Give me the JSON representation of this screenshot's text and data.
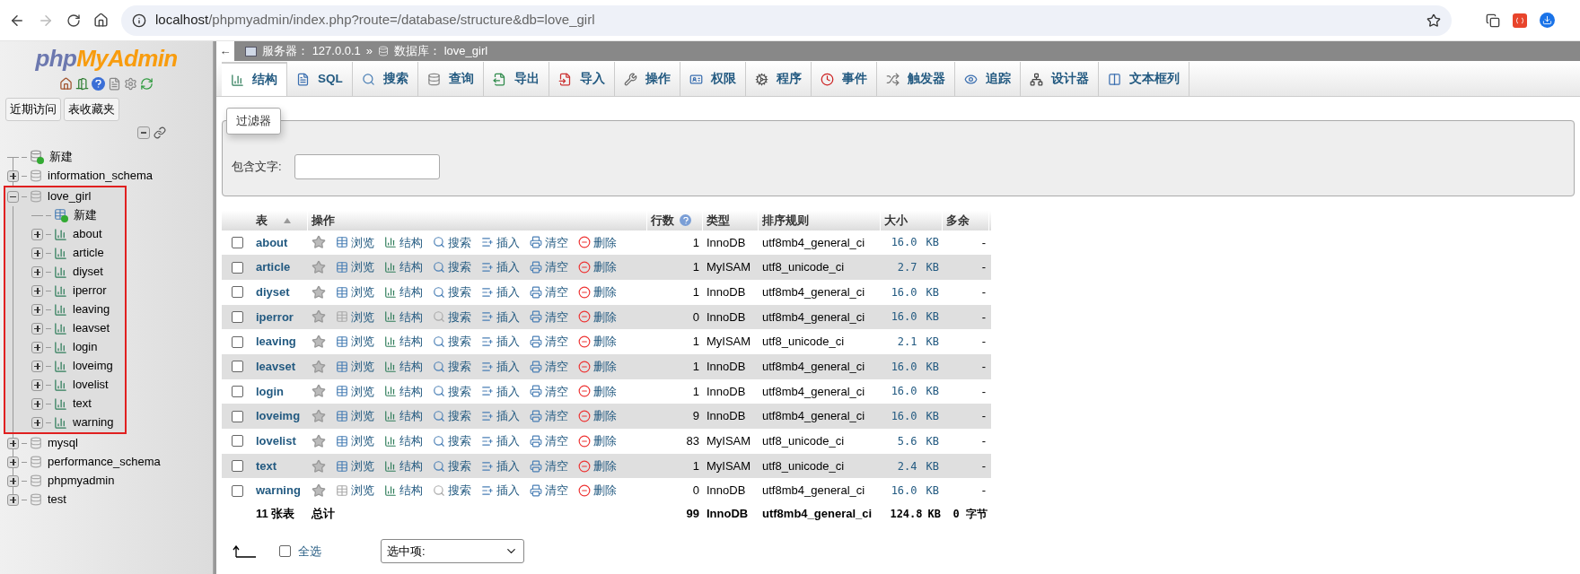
{
  "browser": {
    "host": "localhost",
    "path": "/phpmyadmin/index.php?route=/database/structure&db=love_girl"
  },
  "sidebar": {
    "logo_php": "php",
    "logo_myadmin": "MyAdmin",
    "buttons": [
      "近期访问",
      "表收藏夹"
    ],
    "tree": [
      {
        "label": "新建",
        "kind": "new"
      },
      {
        "label": "information_schema",
        "kind": "db",
        "expanded": false
      },
      {
        "label": "love_girl",
        "kind": "db",
        "expanded": true,
        "highlighted": true,
        "children": [
          {
            "label": "新建",
            "kind": "new-table"
          },
          {
            "label": "about",
            "kind": "table",
            "expanded": false
          },
          {
            "label": "article",
            "kind": "table",
            "expanded": false
          },
          {
            "label": "diyset",
            "kind": "table",
            "expanded": false
          },
          {
            "label": "iperror",
            "kind": "table",
            "expanded": false
          },
          {
            "label": "leaving",
            "kind": "table",
            "expanded": false
          },
          {
            "label": "leavset",
            "kind": "table",
            "expanded": false
          },
          {
            "label": "login",
            "kind": "table",
            "expanded": false
          },
          {
            "label": "loveimg",
            "kind": "table",
            "expanded": false
          },
          {
            "label": "lovelist",
            "kind": "table",
            "expanded": false
          },
          {
            "label": "text",
            "kind": "table",
            "expanded": false
          },
          {
            "label": "warning",
            "kind": "table",
            "expanded": false
          }
        ]
      },
      {
        "label": "mysql",
        "kind": "db",
        "expanded": false
      },
      {
        "label": "performance_schema",
        "kind": "db",
        "expanded": false
      },
      {
        "label": "phpmyadmin",
        "kind": "db",
        "expanded": false
      },
      {
        "label": "test",
        "kind": "db",
        "expanded": false
      }
    ]
  },
  "breadcrumb": {
    "collapse": "←",
    "server_label": "服务器：",
    "server": "127.0.0.1",
    "separator": "»",
    "db_label": "数据库：",
    "db": "love_girl"
  },
  "tabs": [
    {
      "label": "结构",
      "selected": true
    },
    {
      "label": "SQL",
      "selected": false
    },
    {
      "label": "搜索",
      "selected": false
    },
    {
      "label": "查询",
      "selected": false
    },
    {
      "label": "导出",
      "selected": false
    },
    {
      "label": "导入",
      "selected": false
    },
    {
      "label": "操作",
      "selected": false
    },
    {
      "label": "权限",
      "selected": false
    },
    {
      "label": "程序",
      "selected": false
    },
    {
      "label": "事件",
      "selected": false
    },
    {
      "label": "触发器",
      "selected": false
    },
    {
      "label": "追踪",
      "selected": false
    },
    {
      "label": "设计器",
      "selected": false
    },
    {
      "label": "文本框列",
      "selected": false
    }
  ],
  "filter": {
    "legend": "过滤器",
    "label": "包含文字:"
  },
  "table": {
    "columns": [
      "表",
      "操作",
      "行数",
      "类型",
      "排序规则",
      "大小",
      "多余"
    ],
    "rows": [
      {
        "name": "about",
        "checked": false,
        "empty": false,
        "actions": [
          "浏览",
          "结构",
          "搜索",
          "插入",
          "清空",
          "删除"
        ],
        "rows": "1",
        "engine": "InnoDB",
        "collation": "utf8mb4_general_ci",
        "size": "16.0",
        "unit": "KB",
        "overhead": "-"
      },
      {
        "name": "article",
        "checked": false,
        "empty": false,
        "actions": [
          "浏览",
          "结构",
          "搜索",
          "插入",
          "清空",
          "删除"
        ],
        "rows": "1",
        "engine": "MyISAM",
        "collation": "utf8_unicode_ci",
        "size": "2.7",
        "unit": "KB",
        "overhead": "-"
      },
      {
        "name": "diyset",
        "checked": false,
        "empty": false,
        "actions": [
          "浏览",
          "结构",
          "搜索",
          "插入",
          "清空",
          "删除"
        ],
        "rows": "1",
        "engine": "InnoDB",
        "collation": "utf8mb4_general_ci",
        "size": "16.0",
        "unit": "KB",
        "overhead": "-"
      },
      {
        "name": "iperror",
        "checked": false,
        "empty": true,
        "actions": [
          "浏览",
          "结构",
          "搜索",
          "插入",
          "清空",
          "删除"
        ],
        "rows": "0",
        "engine": "InnoDB",
        "collation": "utf8mb4_general_ci",
        "size": "16.0",
        "unit": "KB",
        "overhead": "-"
      },
      {
        "name": "leaving",
        "checked": false,
        "empty": false,
        "actions": [
          "浏览",
          "结构",
          "搜索",
          "插入",
          "清空",
          "删除"
        ],
        "rows": "1",
        "engine": "MyISAM",
        "collation": "utf8_unicode_ci",
        "size": "2.1",
        "unit": "KB",
        "overhead": "-"
      },
      {
        "name": "leavset",
        "checked": false,
        "empty": false,
        "actions": [
          "浏览",
          "结构",
          "搜索",
          "插入",
          "清空",
          "删除"
        ],
        "rows": "1",
        "engine": "InnoDB",
        "collation": "utf8mb4_general_ci",
        "size": "16.0",
        "unit": "KB",
        "overhead": "-"
      },
      {
        "name": "login",
        "checked": false,
        "empty": false,
        "actions": [
          "浏览",
          "结构",
          "搜索",
          "插入",
          "清空",
          "删除"
        ],
        "rows": "1",
        "engine": "InnoDB",
        "collation": "utf8mb4_general_ci",
        "size": "16.0",
        "unit": "KB",
        "overhead": "-"
      },
      {
        "name": "loveimg",
        "checked": false,
        "empty": false,
        "actions": [
          "浏览",
          "结构",
          "搜索",
          "插入",
          "清空",
          "删除"
        ],
        "rows": "9",
        "engine": "InnoDB",
        "collation": "utf8mb4_general_ci",
        "size": "16.0",
        "unit": "KB",
        "overhead": "-"
      },
      {
        "name": "lovelist",
        "checked": false,
        "empty": false,
        "actions": [
          "浏览",
          "结构",
          "搜索",
          "插入",
          "清空",
          "删除"
        ],
        "rows": "83",
        "engine": "MyISAM",
        "collation": "utf8_unicode_ci",
        "size": "5.6",
        "unit": "KB",
        "overhead": "-"
      },
      {
        "name": "text",
        "checked": false,
        "empty": false,
        "actions": [
          "浏览",
          "结构",
          "搜索",
          "插入",
          "清空",
          "删除"
        ],
        "rows": "1",
        "engine": "MyISAM",
        "collation": "utf8_unicode_ci",
        "size": "2.4",
        "unit": "KB",
        "overhead": "-"
      },
      {
        "name": "warning",
        "checked": false,
        "empty": true,
        "actions": [
          "浏览",
          "结构",
          "搜索",
          "插入",
          "清空",
          "删除"
        ],
        "rows": "0",
        "engine": "InnoDB",
        "collation": "utf8mb4_general_ci",
        "size": "16.0",
        "unit": "KB",
        "overhead": "-"
      }
    ],
    "footer": {
      "count": "11 张表",
      "total": "总计",
      "rows": "99",
      "engine": "InnoDB",
      "collation": "utf8mb4_general_ci",
      "size": "124.8",
      "unit": "KB",
      "overhead": "0 字节"
    }
  },
  "bulk": {
    "select_all": "全选",
    "checked": false,
    "select": "选中项:"
  }
}
